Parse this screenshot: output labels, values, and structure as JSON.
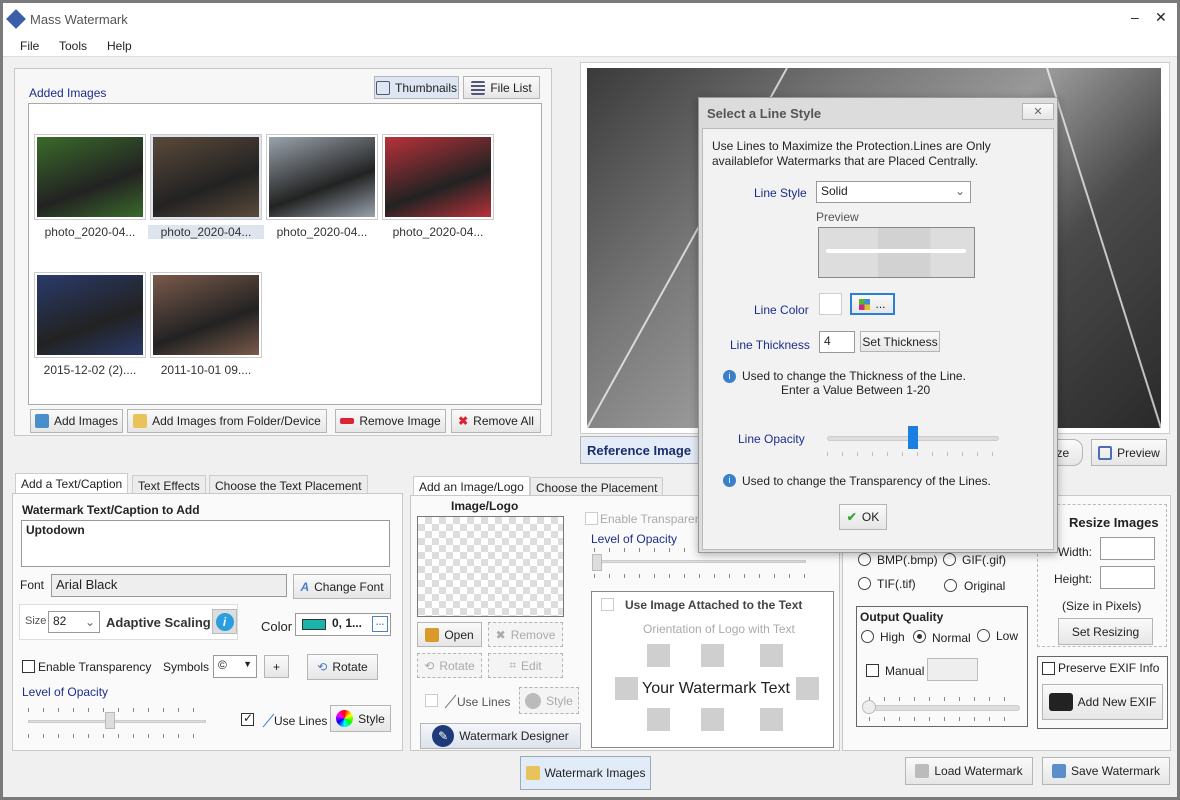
{
  "window": {
    "title": "Mass Watermark",
    "minimize": "–",
    "close": "✕"
  },
  "menu": [
    "File",
    "Tools",
    "Help"
  ],
  "added_images": {
    "title": "Added Images",
    "view_thumbnails": "Thumbnails",
    "view_file_list": "File List",
    "items": [
      {
        "name": "photo_2020-04...",
        "selected": false,
        "color": "#3a6b2a"
      },
      {
        "name": "photo_2020-04...",
        "selected": true,
        "color": "#5b4a3a"
      },
      {
        "name": "photo_2020-04...",
        "selected": false,
        "color": "#9aa3ad"
      },
      {
        "name": "photo_2020-04...",
        "selected": false,
        "color": "#b8323a"
      },
      {
        "name": "2015-12-02 (2)....",
        "selected": false,
        "color": "#2a3a6a"
      },
      {
        "name": "2011-10-01 09....",
        "selected": false,
        "color": "#7a5a4a"
      }
    ],
    "add_images": "Add Images",
    "add_from_folder": "Add Images from Folder/Device",
    "remove_image": "Remove Image",
    "remove_all": "Remove All"
  },
  "preview": {
    "reference_image": "Reference Image",
    "resize_partial": "ize",
    "preview": "Preview"
  },
  "text_panel": {
    "tabs": [
      "Add a Text/Caption",
      "Text Effects",
      "Choose the Text Placement"
    ],
    "caption_label": "Watermark Text/Caption to Add",
    "caption_value": "Uptodown",
    "font_label": "Font",
    "font_value": "Arial Black",
    "change_font": "Change Font",
    "size_label": "Size",
    "size_value": "82",
    "adaptive_scaling": "Adaptive Scaling",
    "color_label": "Color",
    "color_value": "0, 1...",
    "color_swatch": "#1ab5a8",
    "enable_transparency": "Enable Transparency",
    "symbols_label": "Symbols",
    "symbol_value": "©",
    "plus": "+",
    "rotate": "Rotate",
    "opacity_label": "Level of Opacity",
    "opacity_level": 0.45,
    "use_lines": "Use Lines",
    "use_lines_checked": true,
    "style": "Style"
  },
  "logo_panel": {
    "tabs": [
      "Add an Image/Logo",
      "Choose the Placement"
    ],
    "logo_label": "Image/Logo",
    "open": "Open",
    "remove": "Remove",
    "rotate": "Rotate",
    "edit": "Edit",
    "use_lines": "Use Lines",
    "style": "Style",
    "designer": "Watermark Designer",
    "enable_transparency": "Enable Transparen",
    "opacity_label": "Level of Opacity",
    "opacity_level": 0,
    "attach_label": "Use Image Attached to the Text",
    "orientation_label": "Orientation of Logo with Text",
    "sample_text": "Your Watermark Text"
  },
  "output_panel": {
    "formats": [
      "BMP(.bmp)",
      "GIF(.gif)",
      "TIF(.tif)",
      "Original"
    ],
    "quality_label": "Output Quality",
    "quality_options": [
      "High",
      "Normal",
      "Low"
    ],
    "quality_selected": "Normal",
    "manual": "Manual",
    "manual_level": 0,
    "resize_title": "Resize Images",
    "width_label": "Width:",
    "height_label": "Height:",
    "size_note": "(Size in Pixels)",
    "set_resizing": "Set Resizing",
    "preserve_exif": "Preserve EXIF Info",
    "add_exif": "Add New EXIF"
  },
  "bottom": {
    "watermark_images": "Watermark Images",
    "load_watermark": "Load Watermark",
    "save_watermark": "Save Watermark"
  },
  "dialog": {
    "title": "Select a Line Style",
    "close": "✕",
    "intro1": "Use Lines to Maximize the Protection.Lines are Only",
    "intro2": "availablefor Watermarks that are Placed Centrally.",
    "line_style_label": "Line Style",
    "line_style_value": "Solid",
    "preview_label": "Preview",
    "line_color_label": "Line Color",
    "line_color": "#ffffff",
    "color_btn": "...",
    "thickness_label": "Line Thickness",
    "thickness_value": "4",
    "set_thickness": "Set Thickness",
    "thickness_info1": "Used to change the Thickness of the Line.",
    "thickness_info2": "Enter a Value Between 1-20",
    "opacity_label": "Line Opacity",
    "opacity_level": 0.5,
    "opacity_info": "Used to change the Transparency of the Lines.",
    "ok": "OK"
  }
}
